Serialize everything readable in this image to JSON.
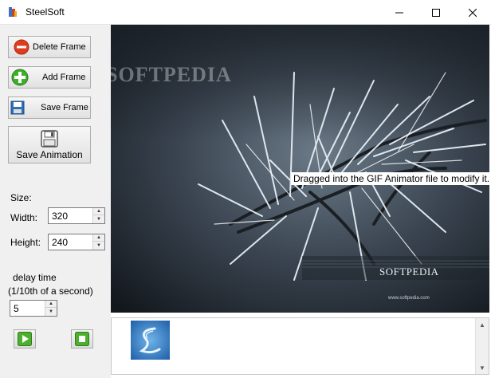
{
  "window": {
    "title": "SteelSoft"
  },
  "toolbar": {
    "delete_frame": "Delete Frame",
    "add_frame": "Add Frame",
    "save_frame": "Save Frame",
    "save_animation": "Save Animation"
  },
  "settings": {
    "size_label": "Size:",
    "width_label": "Width:",
    "width_value": "320",
    "height_label": "Height:",
    "height_value": "240",
    "delay_label_line1": "delay time",
    "delay_label_line2": "(1/10th of a second)",
    "delay_value": "5"
  },
  "preview": {
    "caption": "Dragged into the GIF Animator file to modify it.",
    "watermark_top": "SOFTPEDIA",
    "watermark_bottom": "SOFTPEDIA",
    "url": "www.softpedia.com"
  },
  "colors": {
    "delete_icon": "#e03c1f",
    "add_icon": "#3fae2a",
    "save_icon": "#2f6fb5",
    "play_green": "#4caf2d"
  }
}
